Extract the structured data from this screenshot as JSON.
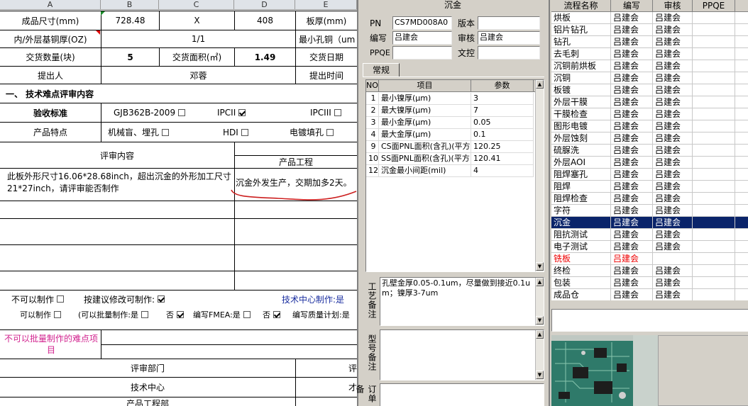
{
  "sheet": {
    "col_headers": [
      "A",
      "B",
      "C",
      "D",
      "E"
    ],
    "r1": {
      "label": "成品尺寸(mm)",
      "b": "728.48",
      "c": "X",
      "d": "408",
      "e": "板厚(mm)"
    },
    "r2": {
      "label": "内/外层基铜厚(OZ)",
      "c": "1/1",
      "e": "最小孔铜（um"
    },
    "r3": {
      "label": "交货数量(块)",
      "b": "5",
      "c": "交货面积(㎡)",
      "d": "1.49",
      "e": "交货日期"
    },
    "r4": {
      "label": "提出人",
      "c": "邓蓉",
      "e": "提出时间"
    },
    "section_title": "一、 技术难点评审内容",
    "r6": {
      "label": "验收标准",
      "opt1": "GJB362B-2009",
      "opt2": "IPCII",
      "opt3": "IPCIII"
    },
    "r7": {
      "label": "产品特点",
      "opt1": "机械盲、埋孔",
      "opt2": "HDI",
      "opt3": "电镀填孔"
    },
    "review_header": "评审内容",
    "prod_eng_header": "产品工程",
    "review_text": "此板外形尺寸16.06*28.68inch，超出沉金的外形加工尺寸21*27inch，请评审能否制作",
    "prod_eng_text": "沉金外发生产，交期加多2天。",
    "opt_row1": {
      "a": "不可以制作",
      "b": "按建议修改可制作:",
      "tech": "技术中心制作:是"
    },
    "opt_row2": {
      "a": "可以制作",
      "b": "(可以批量制作:是",
      "no1": "否",
      "fmea": "编写FMEA:是",
      "no2": "否",
      "plan": "编写质量计划:是"
    },
    "no_batch": "不可以批量制作的难点项目",
    "dept_header": "评审部门",
    "dept_right": "评",
    "dept1": "技术中心",
    "dept1_right": "才",
    "dept2": "产品工程部"
  },
  "mid": {
    "title": "沉金",
    "pn_label": "PN",
    "pn_value": "CS7MD008A0",
    "version_label": "版本",
    "version_value": "",
    "author_label": "编写",
    "author_value": "吕建会",
    "review_label": "审核",
    "review_value": "吕建会",
    "ppqe_label": "PPQE",
    "ppqe_value": "",
    "doc_label": "文控",
    "doc_value": "",
    "tab": "常规",
    "param_headers": [
      "NO",
      "项目",
      "参数"
    ],
    "params": [
      {
        "no": "1",
        "item": "最小镍厚(μm)",
        "value": "3"
      },
      {
        "no": "2",
        "item": "最大镍厚(μm)",
        "value": "7"
      },
      {
        "no": "3",
        "item": "最小金厚(μm)",
        "value": "0.05"
      },
      {
        "no": "4",
        "item": "最大金厚(μm)",
        "value": "0.1"
      },
      {
        "no": "9",
        "item": "CS面PNL面积(含孔)(平方",
        "value": "120.25"
      },
      {
        "no": "10",
        "item": "SS面PNL面积(含孔)(平方",
        "value": "120.41"
      },
      {
        "no": "12",
        "item": "沉金最小间距(mil)",
        "value": "4"
      }
    ],
    "process_note_label": "工艺备注",
    "process_note": "孔壁金厚0.05-0.1um，尽量做到接近0.1um；镍厚3-7um",
    "model_note_label": "型号备注",
    "model_note": "",
    "order_note_label": "订单备",
    "order_note": ""
  },
  "right": {
    "headers": [
      "流程名称",
      "编写",
      "审核",
      "PPQE"
    ],
    "selected_index": 17,
    "red_index": 20,
    "rows": [
      {
        "name": "烘板",
        "author": "吕建会",
        "review": "吕建会",
        "ppqe": ""
      },
      {
        "name": "铝片钻孔",
        "author": "吕建会",
        "review": "吕建会",
        "ppqe": ""
      },
      {
        "name": "钻孔",
        "author": "吕建会",
        "review": "吕建会",
        "ppqe": ""
      },
      {
        "name": "去毛刺",
        "author": "吕建会",
        "review": "吕建会",
        "ppqe": ""
      },
      {
        "name": "沉铜前烘板",
        "author": "吕建会",
        "review": "吕建会",
        "ppqe": ""
      },
      {
        "name": "沉铜",
        "author": "吕建会",
        "review": "吕建会",
        "ppqe": ""
      },
      {
        "name": "板镀",
        "author": "吕建会",
        "review": "吕建会",
        "ppqe": ""
      },
      {
        "name": "外层干膜",
        "author": "吕建会",
        "review": "吕建会",
        "ppqe": ""
      },
      {
        "name": "干膜检查",
        "author": "吕建会",
        "review": "吕建会",
        "ppqe": ""
      },
      {
        "name": "图形电镀",
        "author": "吕建会",
        "review": "吕建会",
        "ppqe": ""
      },
      {
        "name": "外层蚀刻",
        "author": "吕建会",
        "review": "吕建会",
        "ppqe": ""
      },
      {
        "name": "硫脲洗",
        "author": "吕建会",
        "review": "吕建会",
        "ppqe": ""
      },
      {
        "name": "外层AOI",
        "author": "吕建会",
        "review": "吕建会",
        "ppqe": ""
      },
      {
        "name": "阻焊塞孔",
        "author": "吕建会",
        "review": "吕建会",
        "ppqe": ""
      },
      {
        "name": "阻焊",
        "author": "吕建会",
        "review": "吕建会",
        "ppqe": ""
      },
      {
        "name": "阻焊检查",
        "author": "吕建会",
        "review": "吕建会",
        "ppqe": ""
      },
      {
        "name": "字符",
        "author": "吕建会",
        "review": "吕建会",
        "ppqe": ""
      },
      {
        "name": "沉金",
        "author": "吕建会",
        "review": "吕建会",
        "ppqe": ""
      },
      {
        "name": "阻抗测试",
        "author": "吕建会",
        "review": "吕建会",
        "ppqe": ""
      },
      {
        "name": "电子测试",
        "author": "吕建会",
        "review": "吕建会",
        "ppqe": ""
      },
      {
        "name": "铣板",
        "author": "吕建会",
        "review": "",
        "ppqe": ""
      },
      {
        "name": "终检",
        "author": "吕建会",
        "review": "吕建会",
        "ppqe": ""
      },
      {
        "name": "包装",
        "author": "吕建会",
        "review": "吕建会",
        "ppqe": ""
      },
      {
        "name": "成品仓",
        "author": "吕建会",
        "review": "吕建会",
        "ppqe": ""
      }
    ]
  },
  "colors": {
    "selection": "#0a246a",
    "panel": "#d4d0c8",
    "annotation_red": "#cc1f1f",
    "link_blue": "#1b2fa0",
    "magenta": "#d2238f"
  }
}
